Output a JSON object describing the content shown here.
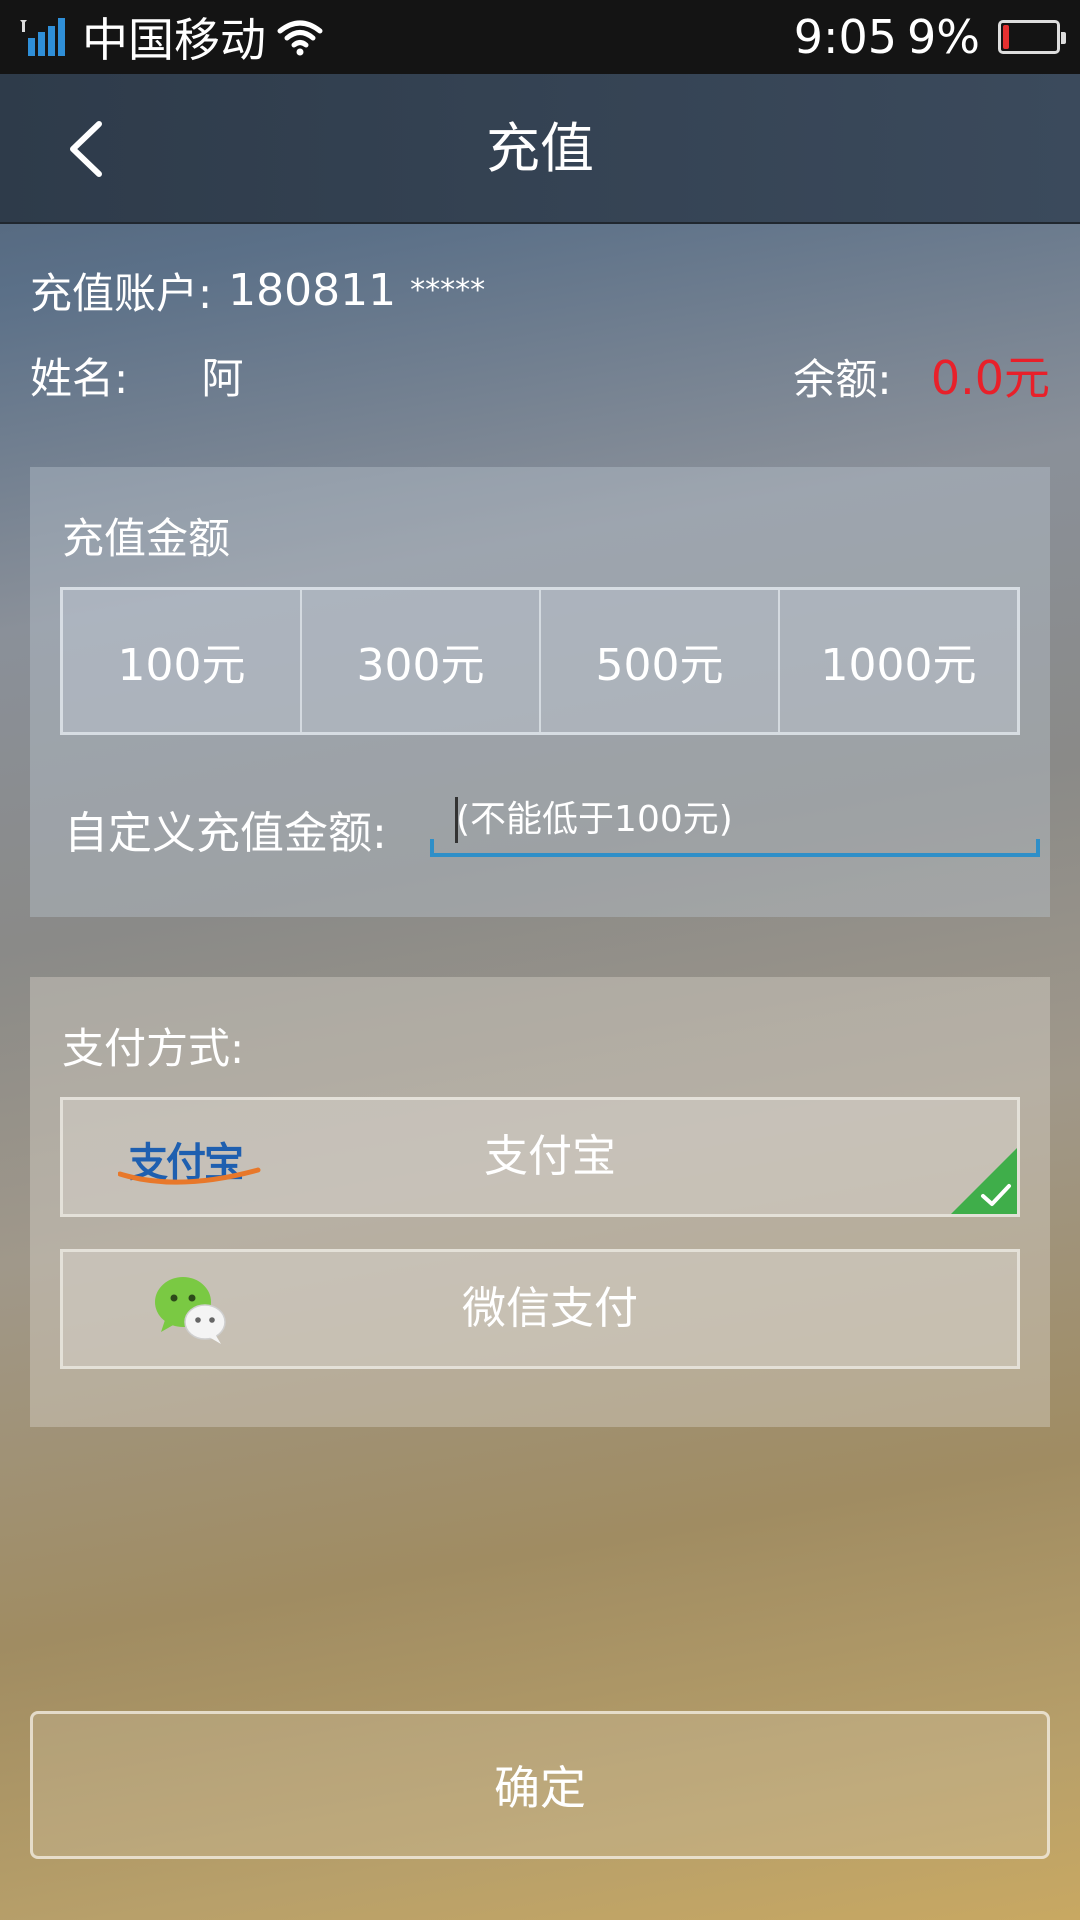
{
  "status_bar": {
    "carrier": "中国移动",
    "time": "9:05",
    "battery": "9%"
  },
  "nav": {
    "title": "充值",
    "back_icon": "chevron-left-icon"
  },
  "account": {
    "label": "充值账户:",
    "number": "180811",
    "masked": "*****"
  },
  "user": {
    "name_label": "姓名:",
    "name_value": "阿",
    "balance_label": "余额:",
    "balance_value": "0.0元"
  },
  "amount_panel": {
    "label": "充值金额",
    "options": [
      "100元",
      "300元",
      "500元",
      "1000元"
    ],
    "custom_label": "自定义充值金额:",
    "custom_placeholder": "(不能低于100元)",
    "custom_value": ""
  },
  "payment_panel": {
    "label": "支付方式:",
    "methods": [
      {
        "logo": "支付宝",
        "label": "支付宝",
        "icon": "alipay-logo-icon",
        "selected": true
      },
      {
        "label": "微信支付",
        "icon": "wechat-logo-icon",
        "selected": false
      }
    ]
  },
  "confirm_label": "确定",
  "colors": {
    "balance": "#e8202a",
    "input_underline": "#2f8fc8",
    "selected_check": "#3fae4a",
    "alipay_blue": "#1e5fb0",
    "alipay_orange": "#e8782a",
    "wechat_green": "#7ac943"
  }
}
